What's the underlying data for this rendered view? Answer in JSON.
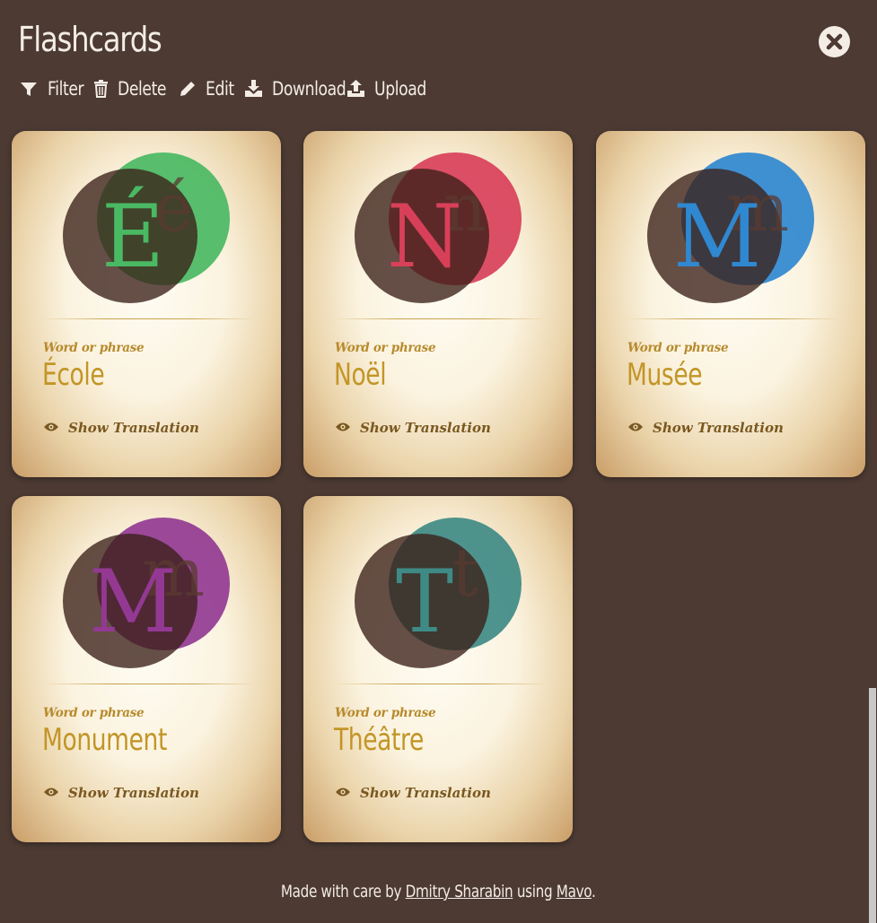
{
  "app": {
    "title": "Flashcards",
    "close_icon": "close-circle-icon"
  },
  "toolbar": {
    "filter": {
      "label": "Filter",
      "icon": "filter-icon"
    },
    "delete": {
      "label": "Delete",
      "icon": "trash-icon"
    },
    "edit": {
      "label": "Edit",
      "icon": "pencil-icon"
    },
    "download": {
      "label": "Download",
      "icon": "download-icon"
    },
    "upload": {
      "label": "Upload",
      "icon": "upload-icon"
    }
  },
  "cards": [
    {
      "caption": "Word or phrase",
      "word": "École",
      "big_letter": "É",
      "small_letter": "é",
      "accent": "#4ab963",
      "show_label": "Show Translation"
    },
    {
      "caption": "Word or phrase",
      "word": "Noël",
      "big_letter": "N",
      "small_letter": "n",
      "accent": "#d8405a",
      "show_label": "Show Translation"
    },
    {
      "caption": "Word or phrase",
      "word": "Musée",
      "big_letter": "M",
      "small_letter": "m",
      "accent": "#2f88d0",
      "show_label": "Show Translation"
    },
    {
      "caption": "Word or phrase",
      "word": "Monument",
      "big_letter": "M",
      "small_letter": "m",
      "accent": "#933993",
      "show_label": "Show Translation"
    },
    {
      "caption": "Word or phrase",
      "word": "Théâtre",
      "big_letter": "T",
      "small_letter": "t",
      "accent": "#3f8a85",
      "show_label": "Show Translation"
    }
  ],
  "footer": {
    "prefix": "Made with care by",
    "author_link": "Dmitry Sharabin",
    "middle": "using",
    "tool_link": "Mavo",
    "suffix": "."
  },
  "colors": {
    "background": "#4c3a33",
    "text_light": "#f3ede6",
    "word": "#c29526",
    "caption": "#b78a2c",
    "show": "#7a5820"
  }
}
